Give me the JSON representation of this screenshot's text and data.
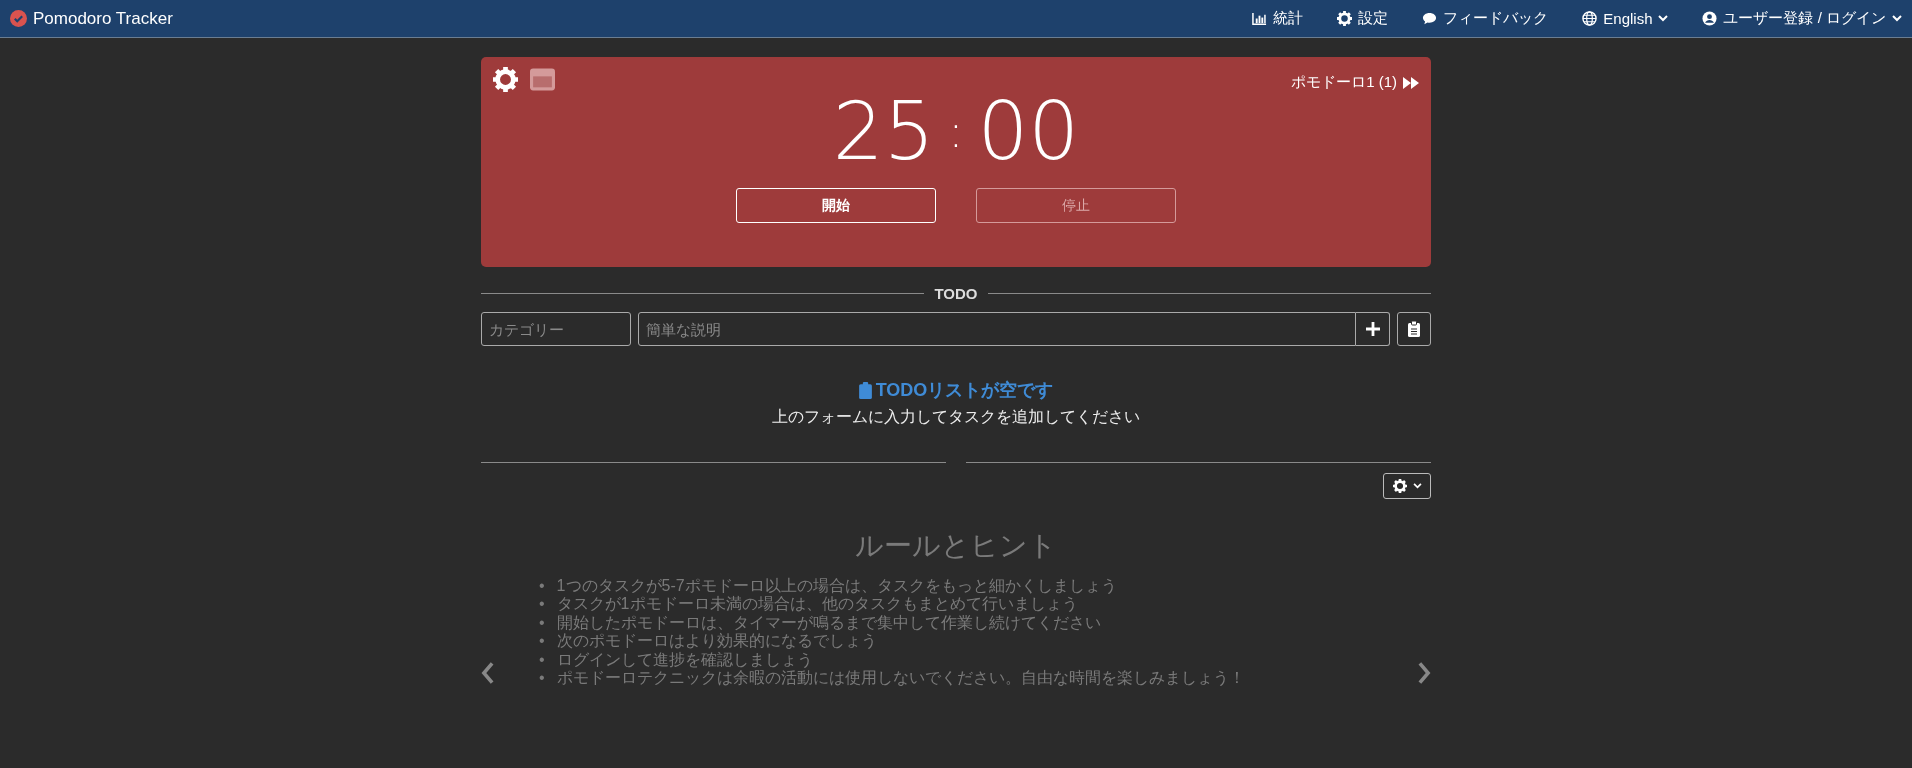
{
  "navbar": {
    "brand": "Pomodoro Tracker",
    "items": [
      {
        "kind": "stats",
        "label": "統計",
        "dropdown": false
      },
      {
        "kind": "settings",
        "label": "設定",
        "dropdown": false
      },
      {
        "kind": "feedback",
        "label": "フィードバック",
        "dropdown": false
      },
      {
        "kind": "language",
        "label": "English",
        "dropdown": true
      },
      {
        "kind": "user",
        "label": "ユーザー登録 / ログイン",
        "dropdown": true
      }
    ]
  },
  "timer": {
    "session": "ポモドーロ1 (1)",
    "minutes": "25",
    "separator": ":",
    "seconds": "00",
    "buttons": [
      {
        "label": "開始",
        "disabled": false
      },
      {
        "label": "停止",
        "disabled": true
      }
    ]
  },
  "todo": {
    "heading": "TODO",
    "category_placeholder": "カテゴリー",
    "description_placeholder": "簡単な説明",
    "empty_title": "TODOリストが空です",
    "empty_hint": "上のフォームに入力してタスクを追加してください"
  },
  "tips": {
    "title": "ルールとヒント",
    "bullet": "•",
    "items": [
      "1つのタスクが5-7ポモドーロ以上の場合は、タスクをもっと細かくしましょう",
      "タスクが1ポモドーロ未満の場合は、他のタスクもまとめて行いましょう",
      "開始したポモドーロは、タイマーが鳴るまで集中して作業し続けてください",
      "次のポモドーロはより効果的になるでしょう",
      "ログインして進捗を確認しましょう",
      "ポモドーロテクニックは余暇の活動には使用しないでください。自由な時間を楽しみましょう！"
    ]
  }
}
